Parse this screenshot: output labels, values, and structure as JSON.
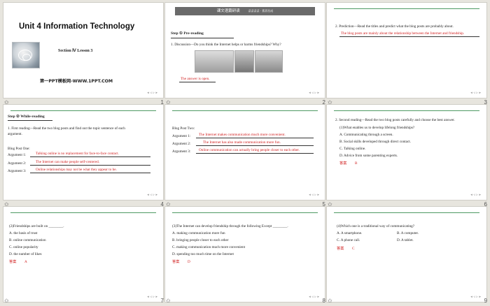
{
  "slides": {
    "s1": {
      "title": "Unit 4   Information Technology",
      "section": "Section Ⅳ    Lesson 3",
      "site": "第一PPT模板网-WWW.1PPT.COM",
      "page": "1"
    },
    "s2": {
      "banner": "课文语篇研读",
      "banner_sub": "读读读读 · 素养形成",
      "step": "Step ①     Pre-reading",
      "q": "1.  Discussion—Do you think the Internet  helps or harms friendships? Why?",
      "answer": "The answer is open.",
      "page": "2"
    },
    "s3": {
      "q": "2.  Prediction—Read the titles and predict what the blog posts are probably about.",
      "answer": "The blog posts are mainly about the relationship between the Internet and friendship.",
      "page": "3"
    },
    "s4": {
      "step": "Step ②     While-reading",
      "q1": "1.  First reading—Read the two blog posts and find out the topic sentence of each",
      "q2": "argument.",
      "post": "Blog Post One:",
      "a1_label": "Argument 1:",
      "a1": "Talking online is no replacement for face-to-face  contact.",
      "a2_label": "Argument 2:",
      "a2": "The Internet  can make people self-centered.",
      "a3_label": "Argument 3:",
      "a3": "Online relationships may not be what they appear  to be.",
      "page": "4"
    },
    "s5": {
      "post": "Blog Post Two:",
      "a1_label": "Argument 1:",
      "a1": "The Internet  makes communication much more convenient.",
      "a2_label": "Argument 2:",
      "a2": "The Internet  has also made communication more fun.",
      "a3_label": "Argument 3:",
      "a3": "Online communication can  actually bring people closer to each  other.",
      "page": "5"
    },
    "s6": {
      "q": "2.  Second reading—Read the two blog posts carefully  and choose  the best answer.",
      "q_sub": "(1)What enables us to develop lifelong friendships?",
      "opts": [
        "A.  Communicating through a screen.",
        "B.  Social skills developed through direct contact.",
        "C.  Talking online.",
        "D.  Advice from  some parenting experts."
      ],
      "ans_label": "答案",
      "ans": "B",
      "page": "6"
    },
    "s7": {
      "q": "(2)Friendships are built on ________.",
      "opts": [
        "A.  the basis of trust",
        "B.  online communication",
        "C.  online popularity",
        "D.  the number of likes"
      ],
      "ans_label": "答案",
      "ans": "A",
      "page": "7"
    },
    "s8": {
      "q": "(3)The Internet can develop friendship through the following Except ________.",
      "opts": [
        "A.  making communication more fun",
        "B.  bringing people closer to each other",
        "C.  making communication much more convenient",
        "D.  spending too much time on the Internet"
      ],
      "ans_label": "答案",
      "ans": "D",
      "page": "8"
    },
    "s9": {
      "q": "(4)Which one is a traditional way of communicating?",
      "opts": [
        "A.  A smartphone.",
        "B.  A computer.",
        "C.  A phone call.",
        "D.  A tablet."
      ],
      "ans_label": "答案",
      "ans": "C",
      "page": "9"
    }
  },
  "nav_text": "◂ ◃ ▹ ▸",
  "star": "✩",
  "colors": {
    "answer_red": "#d01c1c",
    "accent_green": "#4e9a63",
    "background": "#e7e5de"
  },
  "icons": [
    "star-icon",
    "nav-arrows-icon"
  ]
}
